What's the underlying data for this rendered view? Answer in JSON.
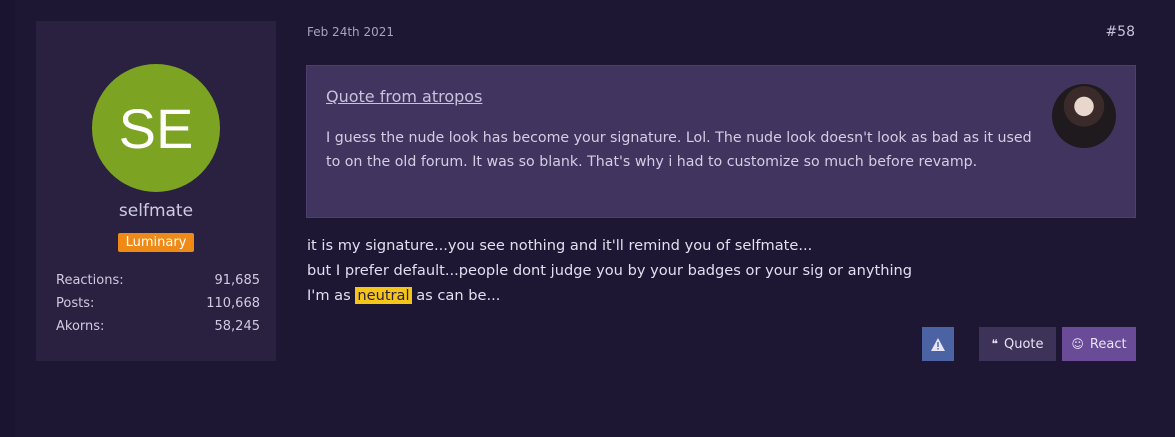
{
  "post": {
    "date": "Feb 24th 2021",
    "number": "#58"
  },
  "user": {
    "initials": "SE",
    "name": "selfmate",
    "rank": "Luminary",
    "stats": [
      {
        "label": "Reactions:",
        "value": "91,685"
      },
      {
        "label": "Posts:",
        "value": "110,668"
      },
      {
        "label": "Akorns:",
        "value": "58,245"
      }
    ]
  },
  "quote": {
    "title": "Quote from atropos",
    "text": "I guess the nude look has become your signature. Lol. The nude look doesn't look as bad as it used to on the old forum. It was so blank. That's why i had to customize so much before revamp."
  },
  "body": {
    "line1": "it is my signature...you see nothing and it'll remind you of selfmate...",
    "line2": "but I prefer default...people dont judge you by your badges or your sig or anything",
    "line3_before": "I'm as ",
    "line3_highlight": "neutral",
    "line3_after": " as can be..."
  },
  "actions": {
    "quote_label": "Quote",
    "react_label": "React"
  },
  "colors": {
    "background": "#1b1430",
    "card": "#2a2141",
    "avatar": "#7da323",
    "badge": "#f08a16",
    "quote_bg": "#41345f",
    "highlight": "#f5c51a"
  }
}
